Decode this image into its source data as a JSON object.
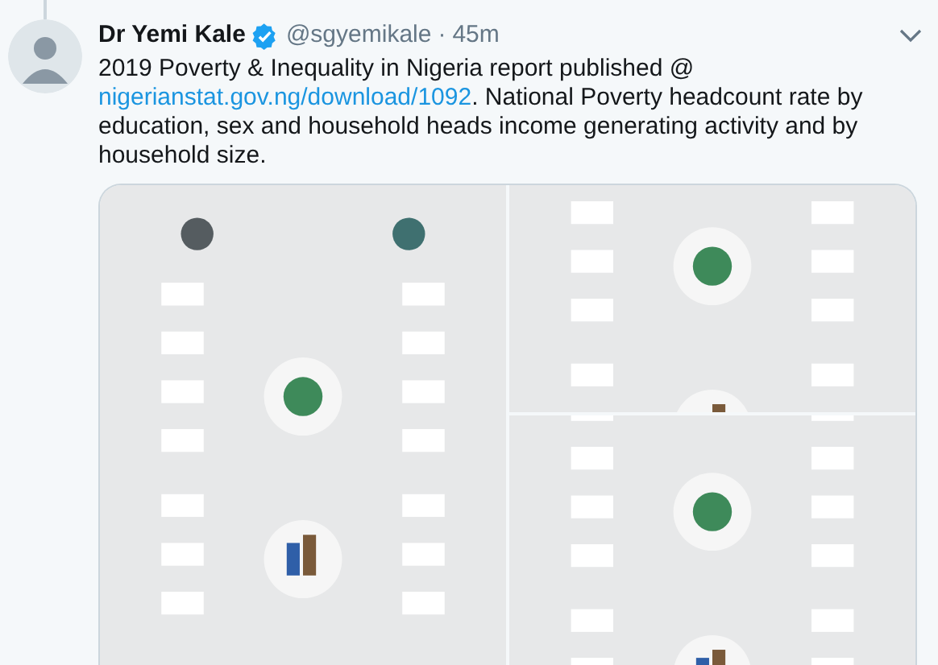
{
  "tweet": {
    "author": "Dr Yemi Kale",
    "verified": true,
    "handle": "@sgyemikale",
    "separator": "·",
    "time": "45m",
    "text_parts": [
      {
        "kind": "text",
        "text": "2019 Poverty & Inequality in Nigeria report published @ "
      },
      {
        "kind": "link",
        "text": "nigerianstat.gov.ng/download/1092"
      },
      {
        "kind": "text",
        "text": ".  National Poverty headcount rate by education, sex and household heads income generating activity and by household size."
      }
    ]
  }
}
